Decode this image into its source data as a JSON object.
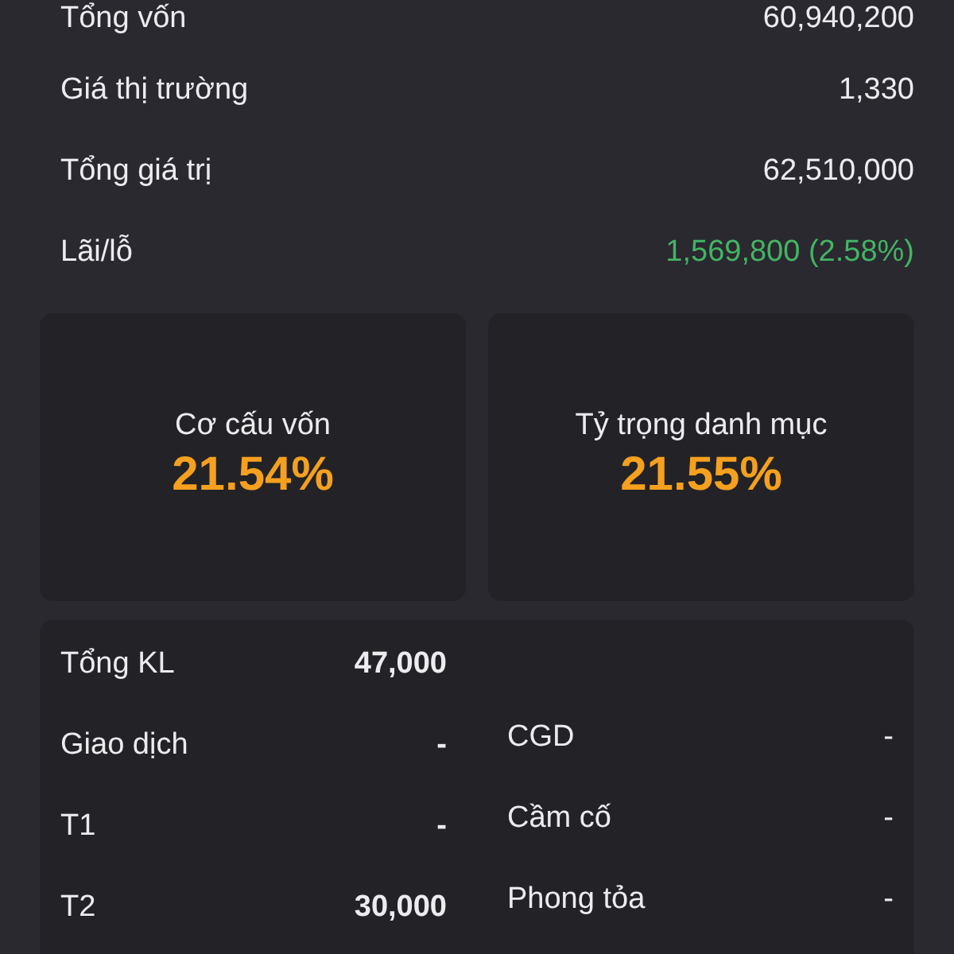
{
  "summary_rows": [
    {
      "label": "Tổng vốn",
      "value": "60,940,200",
      "kind": "plain"
    },
    {
      "label": "Giá thị trường",
      "value": "1,330",
      "kind": "plain"
    },
    {
      "label": "Tổng giá trị",
      "value": "62,510,000",
      "kind": "plain"
    },
    {
      "label": "Lãi/lỗ",
      "value": "1,569,800 (2.58%)",
      "kind": "profit"
    }
  ],
  "ratio_cards": [
    {
      "label": "Cơ cấu vốn",
      "value": "21.54%"
    },
    {
      "label": "Tỷ trọng danh mục",
      "value": "21.55%"
    }
  ],
  "volume_panel": {
    "left_column": [
      {
        "label": "Tổng KL",
        "value": "47,000"
      },
      {
        "label": "Giao dịch",
        "value": "-"
      },
      {
        "label": "T1",
        "value": "-"
      },
      {
        "label": "T2",
        "value": "30,000"
      }
    ],
    "right_column": [
      {
        "label": "CGD",
        "value": "-"
      },
      {
        "label": "Cầm cố",
        "value": "-"
      },
      {
        "label": "Phong tỏa",
        "value": "-"
      }
    ]
  }
}
